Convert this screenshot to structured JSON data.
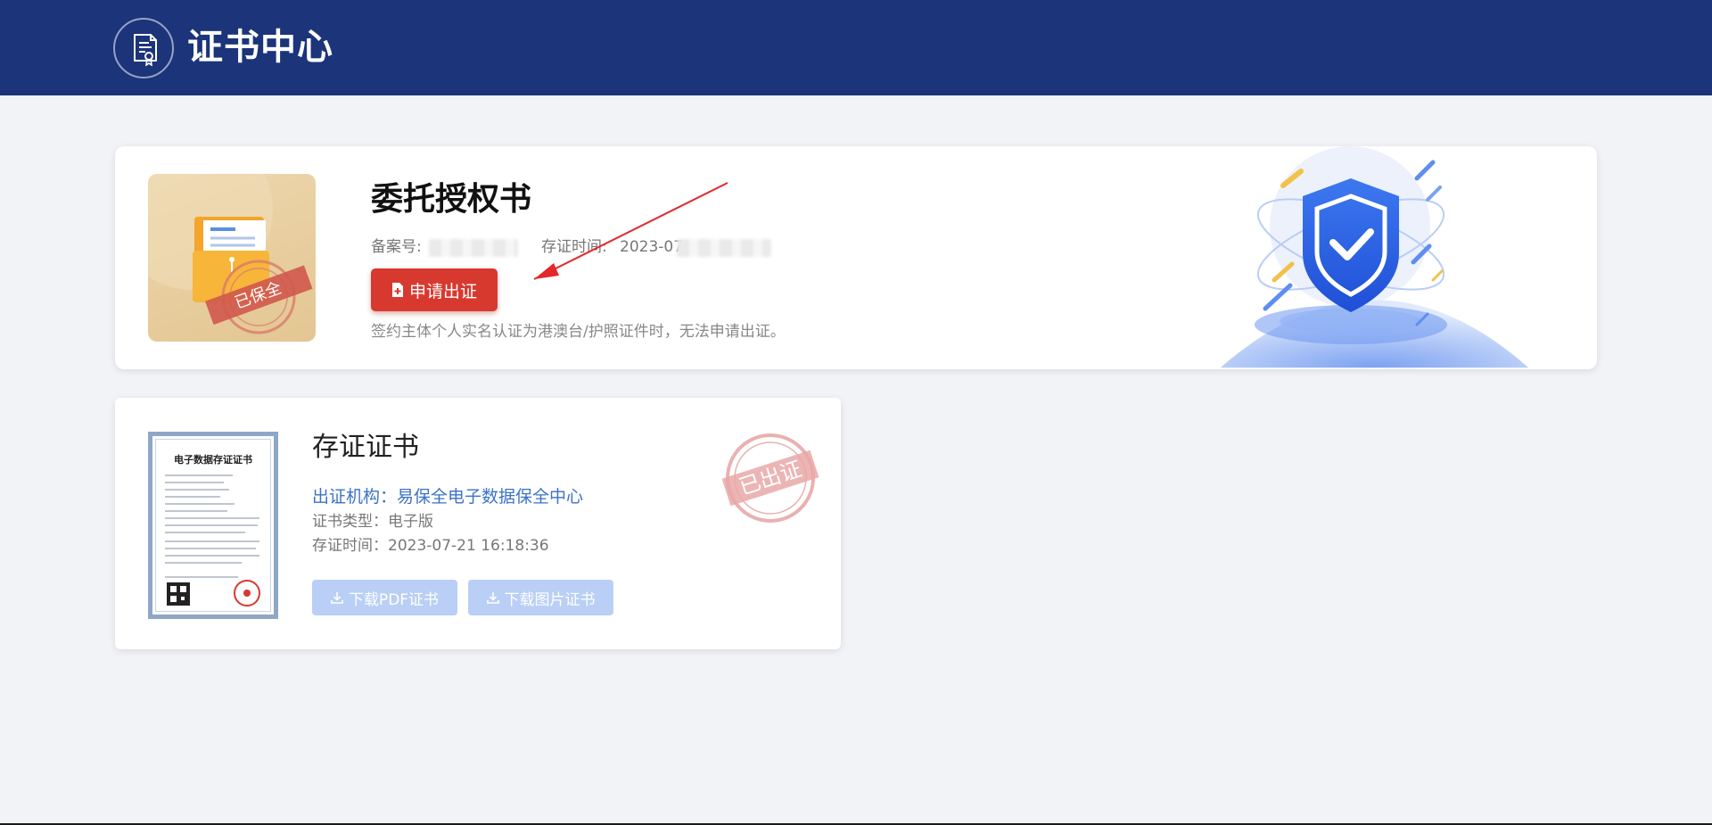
{
  "header": {
    "title": "证书中心"
  },
  "authorization_card": {
    "title": "委托授权书",
    "record_label": "备案号:",
    "time_label": "存证时间:",
    "time_value_visible": "2023-07",
    "apply_button": "申请出证",
    "note": "签约主体个人实名认证为港澳台/护照证件时，无法申请出证。",
    "thumb_stamp": "已保全"
  },
  "certificate_card": {
    "title": "存证证书",
    "issuer": "出证机构：易保全电子数据保全中心",
    "type": "证书类型：电子版",
    "time": "存证时间：2023-07-21 16:18:36",
    "download_pdf": "下载PDF证书",
    "download_image": "下载图片证书",
    "stamp": "已出证",
    "thumb_title": "电子数据存证证书"
  },
  "colors": {
    "header_bg": "#1b347a",
    "apply_button": "#d8392f",
    "issuer_link": "#3c73c6",
    "download_button": "#b9cff5"
  }
}
